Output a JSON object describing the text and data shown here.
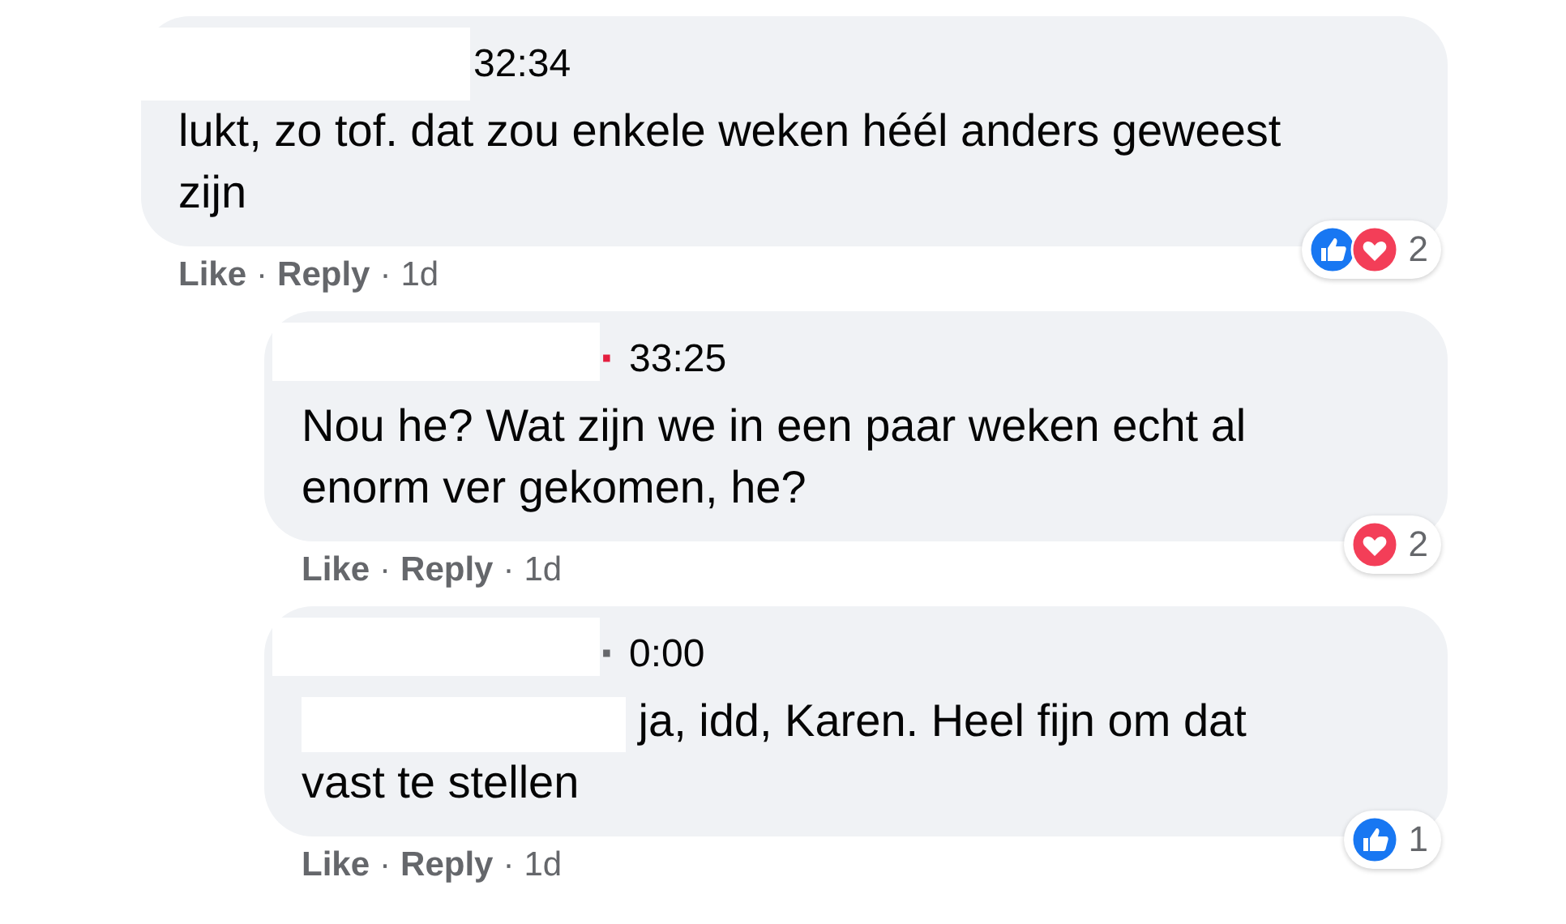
{
  "comments": [
    {
      "time": "32:34",
      "body": "lukt, zo tof. dat zou enkele weken héél anders geweest zijn",
      "actions": [
        "Like",
        "·",
        "Reply",
        "·",
        "1d"
      ],
      "reactions": [
        {
          "kind": "like"
        },
        {
          "kind": "love"
        }
      ],
      "reaction_count": "2",
      "reply": false
    },
    {
      "time": "33:25",
      "color": "#e41e3f",
      "dot": "·",
      "body": "Nou he? Wat zijn we in een paar weken echt al enorm ver gekomen, he?",
      "actions": [
        "Like",
        "·",
        "Reply",
        "·",
        "1d"
      ],
      "reactions": [
        {
          "kind": "love"
        }
      ],
      "reaction_count": "2",
      "reply": true
    },
    {
      "time": "0:00",
      "color": "#65676b",
      "dot": "·",
      "redacted_body_start": true,
      "body": "ja, idd, Karen. Heel fijn om dat vast te stellen",
      "actions": [
        "Like",
        "·",
        "Reply",
        "·",
        "1d"
      ],
      "reactions": [
        {
          "kind": "like"
        }
      ],
      "reaction_count": "1",
      "reply": true
    }
  ]
}
